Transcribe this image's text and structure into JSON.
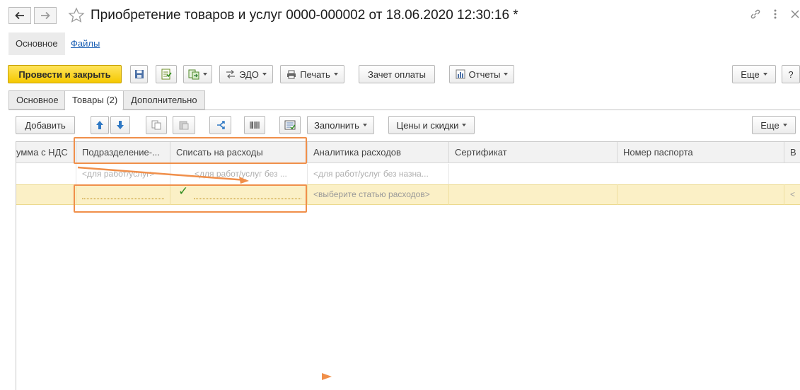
{
  "window": {
    "title": "Приобретение товаров и услуг 0000-000002 от 18.06.2020 12:30:16 *"
  },
  "section_tabs": [
    {
      "label": "Основное"
    },
    {
      "label": "Файлы"
    }
  ],
  "toolbar": {
    "post_close": "Провести и закрыть",
    "edo": "ЭДО",
    "print": "Печать",
    "payment_offset": "Зачет оплаты",
    "reports": "Отчеты",
    "more": "Еще",
    "help": "?"
  },
  "form_tabs": [
    {
      "label": "Основное"
    },
    {
      "label": "Товары (2)"
    },
    {
      "label": "Дополнительно"
    }
  ],
  "table_toolbar": {
    "add": "Добавить",
    "fill": "Заполнить",
    "prices": "Цены и скидки",
    "more": "Еще"
  },
  "table": {
    "columns": [
      "умма с НДС",
      "Подразделение-...",
      "Списать на расходы",
      "Аналитика расходов",
      "Сертификат",
      "Номер паспорта",
      "В"
    ],
    "rows": [
      {
        "subdivision": "<для работ/услуг>",
        "write_off": "<для работ/услуг без ...",
        "analytics": "<для работ/услуг без назна..."
      },
      {
        "subdivision": "",
        "write_off_checked": true,
        "write_off": "",
        "analytics": "<выберите статью расходов>",
        "last": "<"
      }
    ]
  },
  "icons": {
    "back": "arrow-left-icon",
    "forward": "arrow-right-icon",
    "favorite": "star-icon",
    "link": "link-icon",
    "menu": "kebab-menu-icon",
    "close": "close-icon"
  },
  "colors": {
    "primary_button": "#f5c800",
    "selected_row": "#fbf0c6",
    "annotation": "#f08f4a",
    "link": "#1a5fb4"
  }
}
